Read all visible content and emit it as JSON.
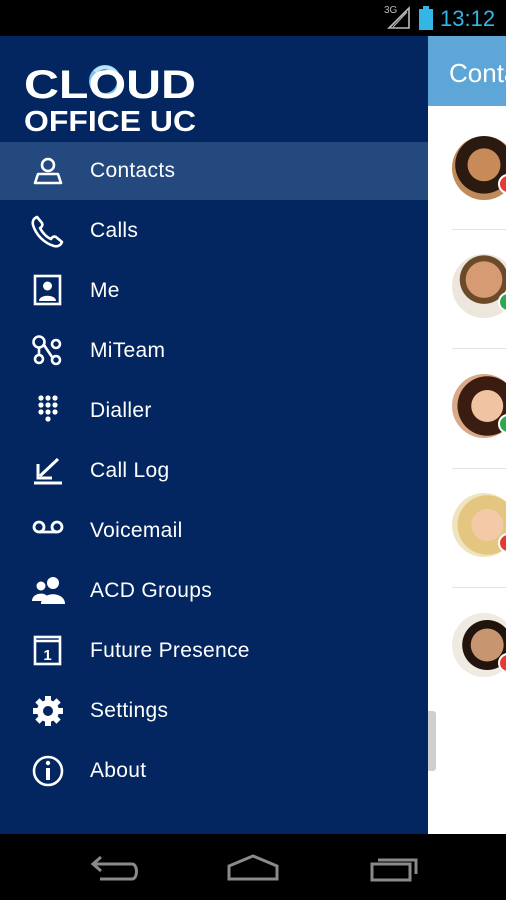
{
  "status_bar": {
    "network": "3G",
    "time": "13:12"
  },
  "app": {
    "logo_line1": "CLOUD",
    "logo_line2": "OFFICE UC"
  },
  "drawer": {
    "items": [
      {
        "label": "Contacts",
        "icon": "contacts-icon",
        "active": true
      },
      {
        "label": "Calls",
        "icon": "phone-icon"
      },
      {
        "label": "Me",
        "icon": "me-icon"
      },
      {
        "label": "MiTeam",
        "icon": "miteam-icon"
      },
      {
        "label": "Dialler",
        "icon": "dialpad-icon"
      },
      {
        "label": "Call Log",
        "icon": "call-log-icon"
      },
      {
        "label": "Voicemail",
        "icon": "voicemail-icon"
      },
      {
        "label": "ACD Groups",
        "icon": "acd-groups-icon"
      },
      {
        "label": "Future Presence",
        "icon": "calendar-icon"
      },
      {
        "label": "Settings",
        "icon": "gear-icon"
      },
      {
        "label": "About",
        "icon": "info-icon"
      }
    ]
  },
  "content": {
    "title": "Contacts",
    "contacts": [
      {
        "presence": "busy"
      },
      {
        "presence": "available"
      },
      {
        "presence": "available"
      },
      {
        "presence": "busy"
      },
      {
        "presence": "busy"
      }
    ]
  },
  "colors": {
    "drawer_bg": "#032660",
    "active_item_bg": "#23497e",
    "header_bg": "#5ea6d8",
    "status_time": "#33b5e5",
    "available": "#2fa84f",
    "busy": "#e53935"
  }
}
